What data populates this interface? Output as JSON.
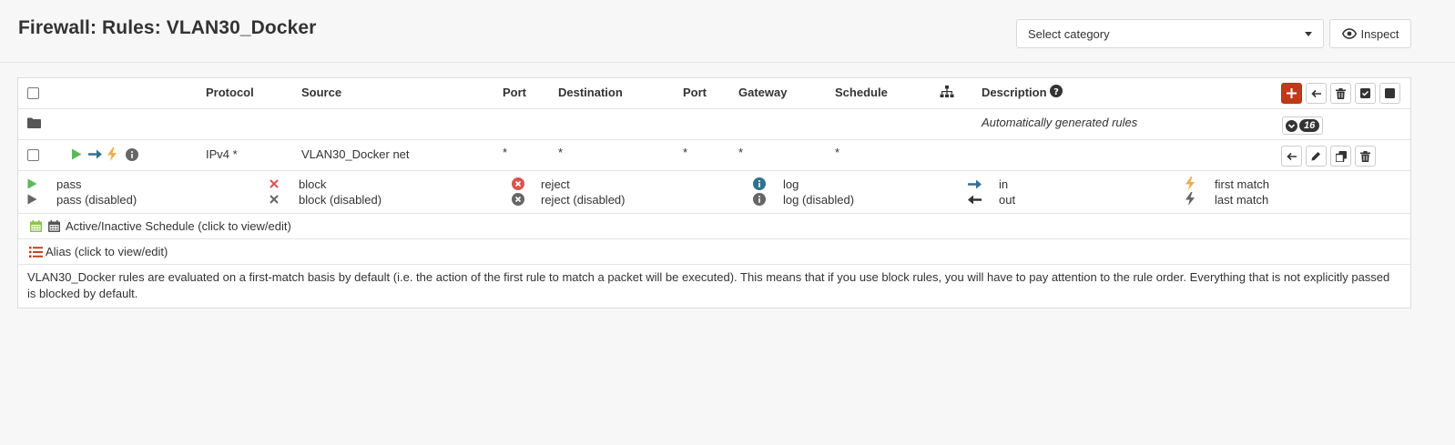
{
  "header": {
    "title": "Firewall: Rules: VLAN30_Docker",
    "category_placeholder": "Select category",
    "inspect_label": "Inspect"
  },
  "table": {
    "columns": {
      "protocol": "Protocol",
      "source": "Source",
      "port": "Port",
      "destination": "Destination",
      "port2": "Port",
      "gateway": "Gateway",
      "schedule": "Schedule",
      "description": "Description"
    },
    "auto_group": {
      "label": "Automatically generated rules",
      "count": "16"
    },
    "rules": [
      {
        "protocol": "IPv4 *",
        "source": "VLAN30_Docker net",
        "port": "*",
        "destination": "*",
        "port2": "*",
        "gateway": "*",
        "schedule": "*",
        "description": ""
      }
    ]
  },
  "legend": {
    "pass": "pass",
    "pass_disabled": "pass (disabled)",
    "block": "block",
    "block_disabled": "block (disabled)",
    "reject": "reject",
    "reject_disabled": "reject (disabled)",
    "log": "log",
    "log_disabled": "log (disabled)",
    "in": "in",
    "out": "out",
    "first_match": "first match",
    "last_match": "last match",
    "schedule_note": "Active/Inactive Schedule (click to view/edit)",
    "alias_note": "Alias (click to view/edit)"
  },
  "info_text": "VLAN30_Docker rules are evaluated on a first-match basis by default (i.e. the action of the first rule to match a packet will be executed). This means that if you use block rules, you will have to pay attention to the rule order. Everything that is not explicitly passed is blocked by default.",
  "colors": {
    "pass": "#5cb85c",
    "in_arrow": "#31708f",
    "first_match": "#f0ad4e",
    "reject": "#d9534f",
    "log": "#31708f",
    "add_button": "#c03a1a",
    "schedule": "#8bc34a",
    "alias": "#c03a1a"
  }
}
